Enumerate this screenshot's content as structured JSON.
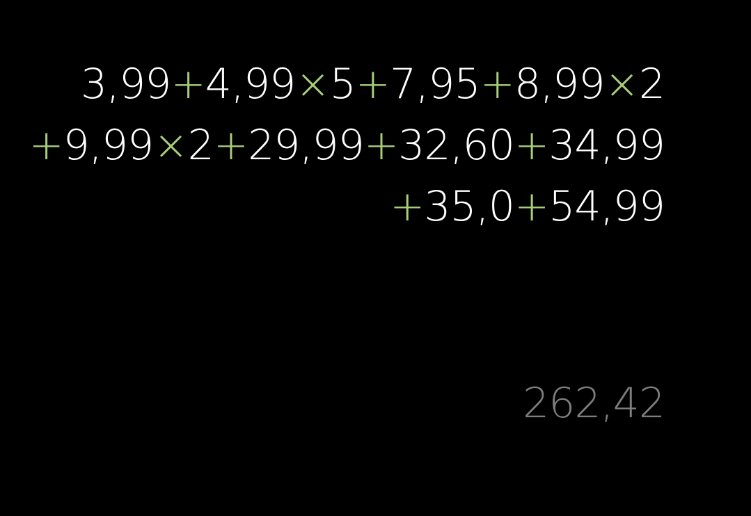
{
  "expression": {
    "lines": [
      [
        "3,99",
        "+",
        "4,99",
        "×",
        "5",
        "+",
        "7,95",
        "+",
        "8,99",
        "×",
        "2"
      ],
      [
        "+",
        "9,99",
        "×",
        "2",
        "+",
        "29,99",
        "+",
        "32,60",
        "+",
        "34,99"
      ],
      [
        "+",
        "35,0",
        "+",
        "54,99"
      ]
    ]
  },
  "result": {
    "value": "262,42"
  },
  "colors": {
    "background": "#000000",
    "operand": "#ffffff",
    "operator": "#a8cf7a",
    "result": "#7d7d7d"
  }
}
